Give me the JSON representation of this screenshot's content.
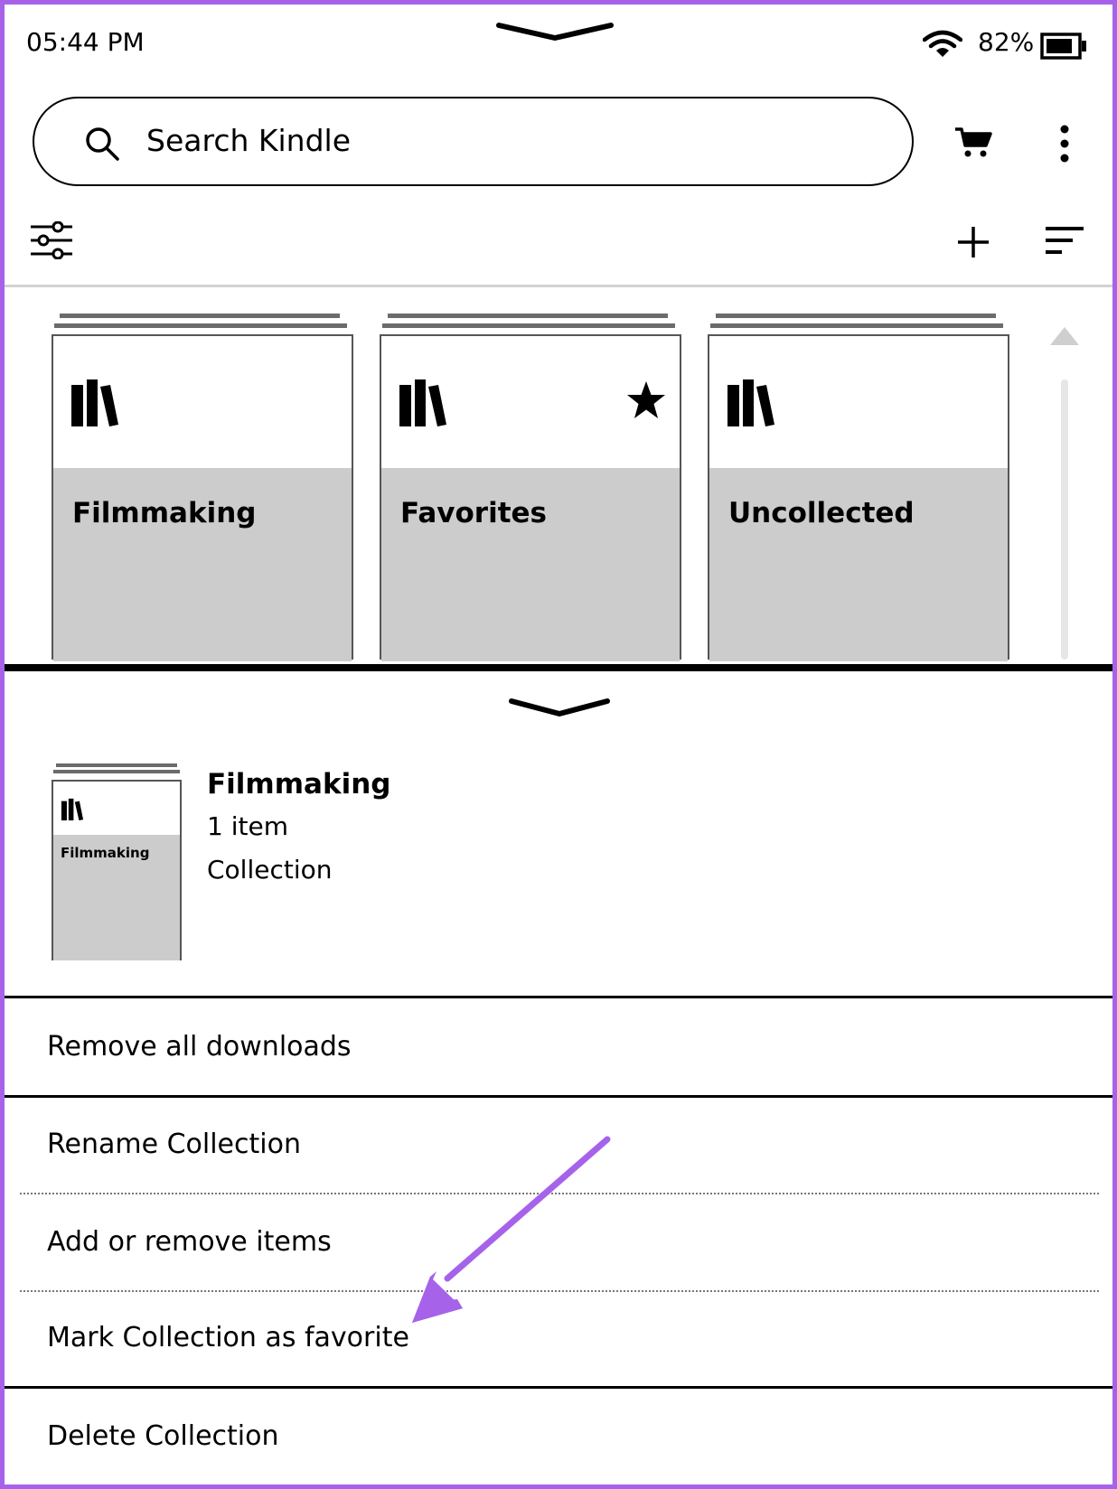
{
  "status": {
    "time": "05:44 PM",
    "battery": "82%",
    "battery_level": 0.82
  },
  "search": {
    "placeholder": "Search Kindle"
  },
  "icons": {
    "search": "search-icon",
    "cart": "cart-icon",
    "more": "more-vertical-icon",
    "filter": "filter-sliders-icon",
    "add": "plus-icon",
    "sort": "sort-icon",
    "collection": "bookshelf-icon",
    "favorite": "star-icon"
  },
  "collections": [
    {
      "title": "Filmmaking",
      "favorite": false
    },
    {
      "title": "Favorites",
      "favorite": true
    },
    {
      "title": "Uncollected",
      "favorite": false
    }
  ],
  "detail": {
    "thumb_title": "Filmmaking",
    "title": "Filmmaking",
    "count": "1 item",
    "type": "Collection"
  },
  "menu": [
    "Remove all downloads",
    "Rename Collection",
    "Add or remove items",
    "Mark Collection as favorite",
    "Delete Collection"
  ],
  "colors": {
    "accent_annotation": "#a663ea",
    "tile_gray": "#cccccc"
  }
}
